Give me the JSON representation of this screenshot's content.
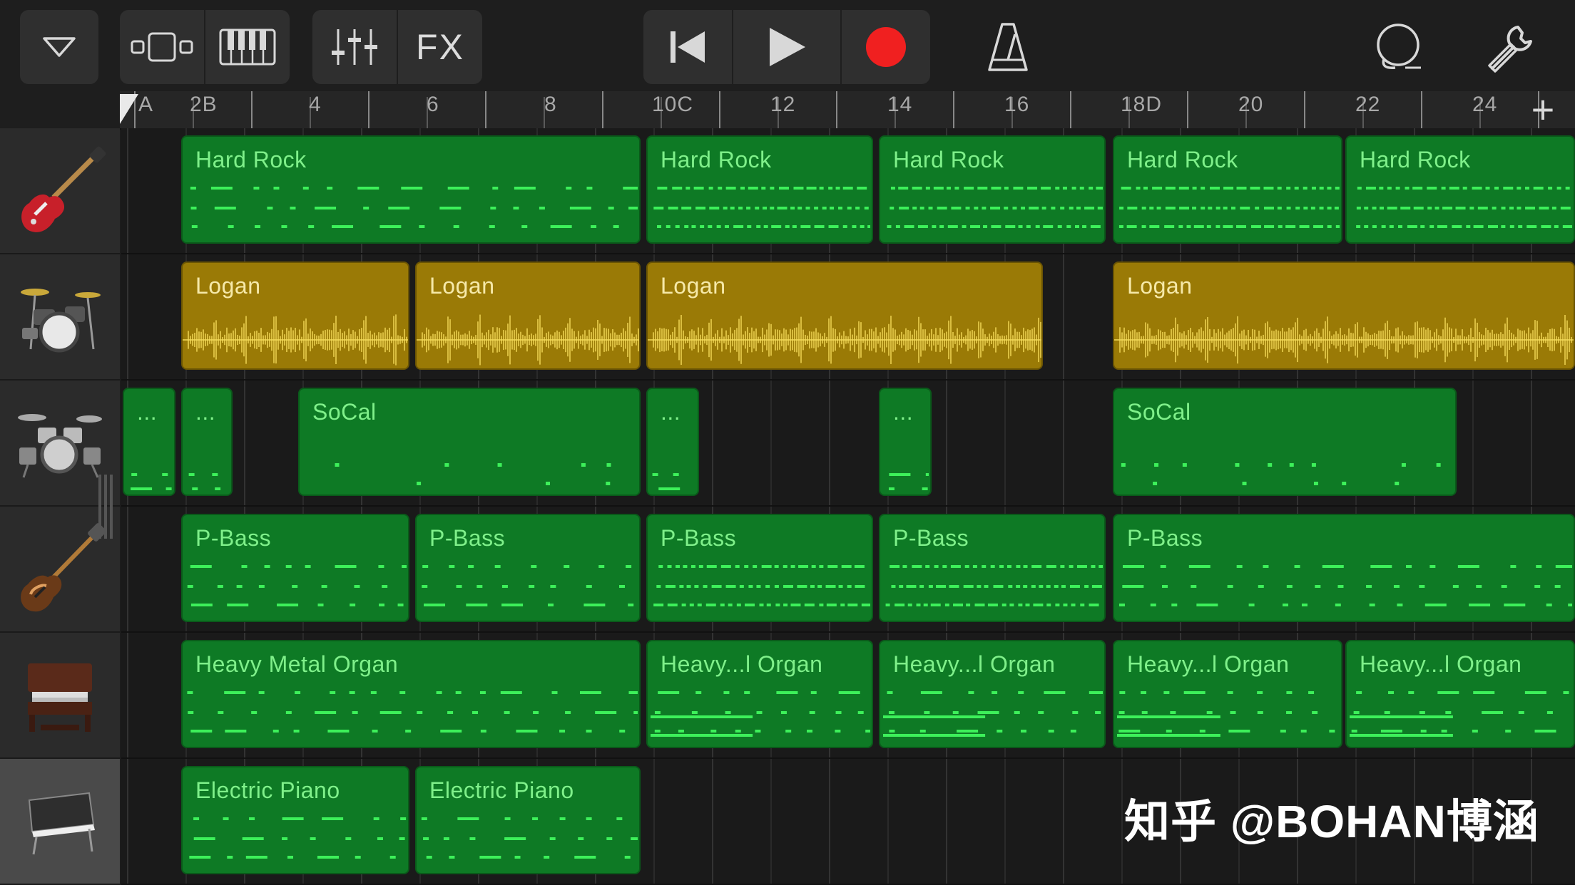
{
  "toolbar": {
    "fx_label": "FX",
    "icons": [
      "dropdown-triangle-icon",
      "tracks-view-icon",
      "keyboard-icon",
      "mixer-sliders-icon",
      "go-to-start-icon",
      "play-icon",
      "record-icon",
      "metronome-icon",
      "loop-browser-icon",
      "settings-wrench-icon"
    ],
    "record_color": "#f02020"
  },
  "ruler": {
    "labels": [
      "A",
      "2B",
      "4",
      "6",
      "8",
      "10C",
      "12",
      "14",
      "16",
      "18D",
      "20",
      "22",
      "24"
    ],
    "add_label": "+"
  },
  "tracks": [
    {
      "instrument": "electric-guitar-icon",
      "regions": [
        {
          "name": "Hard Rock",
          "type": "midi"
        },
        {
          "name": "Hard Rock",
          "type": "midi"
        },
        {
          "name": "Hard Rock",
          "type": "midi"
        },
        {
          "name": "Hard Rock",
          "type": "midi"
        },
        {
          "name": "Hard Rock",
          "type": "midi"
        }
      ]
    },
    {
      "instrument": "drum-kit-icon",
      "regions": [
        {
          "name": "Logan",
          "type": "audio"
        },
        {
          "name": "Logan",
          "type": "audio"
        },
        {
          "name": "Logan",
          "type": "audio"
        },
        {
          "name": "Logan",
          "type": "audio"
        }
      ]
    },
    {
      "instrument": "drum-machine-icon",
      "regions": [
        {
          "name": "...",
          "type": "midi"
        },
        {
          "name": "...",
          "type": "midi"
        },
        {
          "name": "SoCal",
          "type": "midi"
        },
        {
          "name": "...",
          "type": "midi"
        },
        {
          "name": "...",
          "type": "midi"
        },
        {
          "name": "SoCal",
          "type": "midi"
        }
      ]
    },
    {
      "instrument": "bass-guitar-icon",
      "regions": [
        {
          "name": "P-Bass",
          "type": "midi"
        },
        {
          "name": "P-Bass",
          "type": "midi"
        },
        {
          "name": "P-Bass",
          "type": "midi"
        },
        {
          "name": "P-Bass",
          "type": "midi"
        },
        {
          "name": "P-Bass",
          "type": "midi"
        }
      ]
    },
    {
      "instrument": "organ-icon",
      "regions": [
        {
          "name": "Heavy Metal Organ",
          "type": "midi"
        },
        {
          "name": "Heavy...l Organ",
          "type": "midi"
        },
        {
          "name": "Heavy...l Organ",
          "type": "midi"
        },
        {
          "name": "Heavy...l Organ",
          "type": "midi"
        },
        {
          "name": "Heavy...l Organ",
          "type": "midi"
        }
      ]
    },
    {
      "instrument": "electric-piano-icon",
      "regions": [
        {
          "name": "Electric Piano",
          "type": "midi"
        },
        {
          "name": "Electric Piano",
          "type": "midi"
        }
      ]
    }
  ],
  "colors": {
    "midi_region": "#0e7a25",
    "midi_note": "#3df05a",
    "audio_region": "#9a7a06",
    "audio_wave": "#f5dc5a"
  },
  "watermark": "知乎 @BOHAN博涵"
}
